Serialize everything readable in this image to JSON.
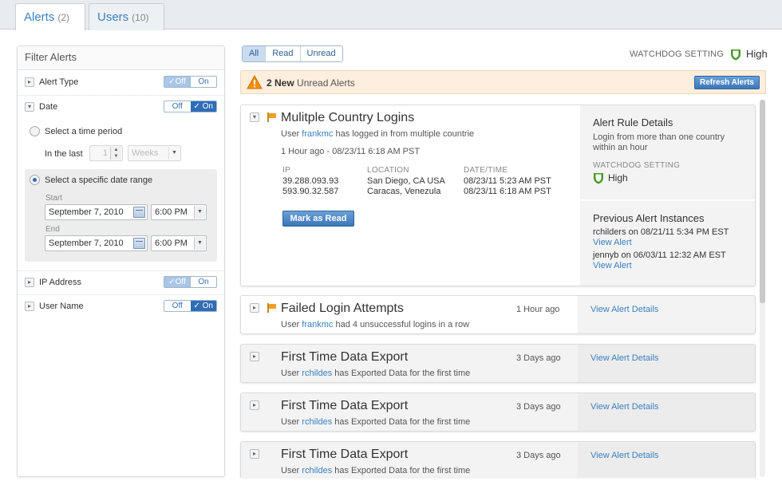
{
  "tabs": [
    {
      "label": "Alerts",
      "count": "(2)"
    },
    {
      "label": "Users",
      "count": "(10)"
    }
  ],
  "filter": {
    "title": "Filter Alerts",
    "alert_type": {
      "label": "Alert Type",
      "off": "Off",
      "on": "On",
      "value": "On"
    },
    "date": {
      "label": "Date",
      "off": "Off",
      "on": "On",
      "value": "On"
    },
    "time_period": {
      "label": "Select a time period",
      "in_last": "In the last",
      "amount": "1",
      "unit": "Weeks"
    },
    "date_range": {
      "label": "Select a specific date range",
      "start_label": "Start",
      "start_date": "September 7, 2010",
      "start_time": "6:00 PM",
      "end_label": "End",
      "end_date": "September 7, 2010",
      "end_time": "6:00 PM"
    },
    "ip_address": {
      "label": "IP Address",
      "off": "Off",
      "on": "On",
      "value": "Off"
    },
    "user_name": {
      "label": "User Name",
      "off": "Off",
      "on": "On",
      "value": "On"
    }
  },
  "view_filter": [
    "All",
    "Read",
    "Unread"
  ],
  "watchdog": {
    "label": "WATCHDOG SETTING",
    "level": "High"
  },
  "banner": {
    "count": "2 New",
    "text": "Unread Alerts",
    "refresh": "Refresh Alerts"
  },
  "expanded_alert": {
    "title": "Mulitple Country Logins",
    "sub_pre": "User",
    "user": "frankmc",
    "sub_post": "has logged in from multiple countrie",
    "when": "1 Hour ago - 08/23/11 6:18 AM PST",
    "columns": {
      "ip": "IP",
      "location": "LOCATION",
      "datetime": "DATE/TIME"
    },
    "rows": [
      {
        "ip": "39.288.093.93",
        "location": "San Diego, CA USA",
        "datetime": "08/23/11 5:23 AM PST"
      },
      {
        "ip": "593.90.32.587",
        "location": "Caracas, Venezula",
        "datetime": "08/23/11 6:18 AM PST"
      }
    ],
    "mark_read": "Mark as Read",
    "rule": {
      "title": "Alert Rule Details",
      "desc": "Login from more than one country within an hour",
      "wd_label": "WATCHDOG SETTING",
      "wd_level": "High"
    },
    "previous": {
      "title": "Previous Alert Instances",
      "items": [
        {
          "text": "rchilders on 08/21/11 5:34 PM EST",
          "link": "View Alert"
        },
        {
          "text": "jennyb on 06/03/11 12:32 AM EST",
          "link": "View Alert"
        }
      ]
    }
  },
  "alerts": [
    {
      "title": "Failed Login Attempts",
      "sub_pre": "User",
      "user": "frankmc",
      "sub_post": "had 4 unsuccessful logins in a row",
      "time": "1 Hour ago",
      "link": "View Alert Details",
      "flag": "true"
    },
    {
      "title": "First Time Data Export",
      "sub_pre": "User",
      "user": "rchildes",
      "sub_post": "has Exported Data for the first time",
      "time": "3 Days ago",
      "link": "View Alert Details"
    },
    {
      "title": "First Time Data Export",
      "sub_pre": "User",
      "user": "rchildes",
      "sub_post": "has Exported Data for the first time",
      "time": "3 Days ago",
      "link": "View Alert Details"
    },
    {
      "title": "First Time Data Export",
      "sub_pre": "User",
      "user": "rchildes",
      "sub_post": "has Exported Data for the first time",
      "time": "3 Days ago",
      "link": "View Alert Details"
    }
  ],
  "colors": {
    "accent": "#2f6db5",
    "link": "#3a80c0",
    "flag": "#f0a028",
    "banner": "#fdeedd",
    "shield": "#4a9a2a"
  }
}
